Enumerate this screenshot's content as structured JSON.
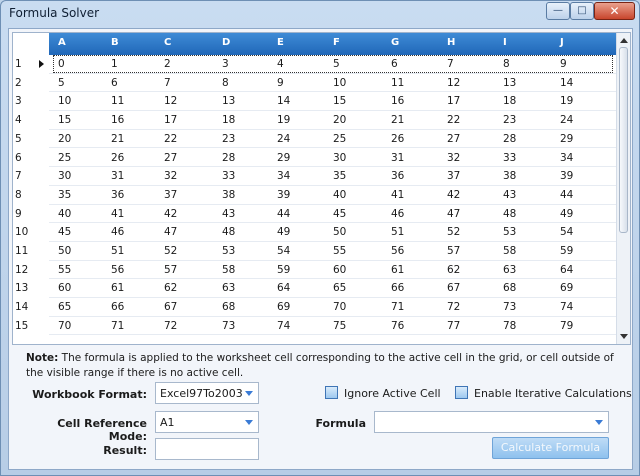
{
  "window": {
    "title": "Formula Solver",
    "controls": {
      "minimize": "—",
      "maximize": "□",
      "close": "✕"
    }
  },
  "grid": {
    "columns": [
      "A",
      "B",
      "C",
      "D",
      "E",
      "F",
      "G",
      "H",
      "I",
      "J"
    ],
    "active_row": 0,
    "rows": [
      {
        "num": "1",
        "cells": [
          "0",
          "1",
          "2",
          "3",
          "4",
          "5",
          "6",
          "7",
          "8",
          "9"
        ]
      },
      {
        "num": "2",
        "cells": [
          "5",
          "6",
          "7",
          "8",
          "9",
          "10",
          "11",
          "12",
          "13",
          "14"
        ]
      },
      {
        "num": "3",
        "cells": [
          "10",
          "11",
          "12",
          "13",
          "14",
          "15",
          "16",
          "17",
          "18",
          "19"
        ]
      },
      {
        "num": "4",
        "cells": [
          "15",
          "16",
          "17",
          "18",
          "19",
          "20",
          "21",
          "22",
          "23",
          "24"
        ]
      },
      {
        "num": "5",
        "cells": [
          "20",
          "21",
          "22",
          "23",
          "24",
          "25",
          "26",
          "27",
          "28",
          "29"
        ]
      },
      {
        "num": "6",
        "cells": [
          "25",
          "26",
          "27",
          "28",
          "29",
          "30",
          "31",
          "32",
          "33",
          "34"
        ]
      },
      {
        "num": "7",
        "cells": [
          "30",
          "31",
          "32",
          "33",
          "34",
          "35",
          "36",
          "37",
          "38",
          "39"
        ]
      },
      {
        "num": "8",
        "cells": [
          "35",
          "36",
          "37",
          "38",
          "39",
          "40",
          "41",
          "42",
          "43",
          "44"
        ]
      },
      {
        "num": "9",
        "cells": [
          "40",
          "41",
          "42",
          "43",
          "44",
          "45",
          "46",
          "47",
          "48",
          "49"
        ]
      },
      {
        "num": "10",
        "cells": [
          "45",
          "46",
          "47",
          "48",
          "49",
          "50",
          "51",
          "52",
          "53",
          "54"
        ]
      },
      {
        "num": "11",
        "cells": [
          "50",
          "51",
          "52",
          "53",
          "54",
          "55",
          "56",
          "57",
          "58",
          "59"
        ]
      },
      {
        "num": "12",
        "cells": [
          "55",
          "56",
          "57",
          "58",
          "59",
          "60",
          "61",
          "62",
          "63",
          "64"
        ]
      },
      {
        "num": "13",
        "cells": [
          "60",
          "61",
          "62",
          "63",
          "64",
          "65",
          "66",
          "67",
          "68",
          "69"
        ]
      },
      {
        "num": "14",
        "cells": [
          "65",
          "66",
          "67",
          "68",
          "69",
          "70",
          "71",
          "72",
          "73",
          "74"
        ]
      },
      {
        "num": "15",
        "cells": [
          "70",
          "71",
          "72",
          "73",
          "74",
          "75",
          "76",
          "77",
          "78",
          "79"
        ]
      }
    ]
  },
  "note": {
    "prefix": "Note:",
    "text": " The formula is applied to the worksheet cell corresponding to the active cell in the grid, or cell outside of the visible range if there is no active cell."
  },
  "form": {
    "workbook_format_label": "Workbook Format:",
    "workbook_format_value": "Excel97To2003",
    "cell_reference_mode_label": "Cell Reference Mode:",
    "cell_reference_mode_value": "A1",
    "result_label": "Result:",
    "result_value": "",
    "ignore_active_cell_label": "Ignore Active Cell",
    "enable_iterative_label": "Enable Iterative Calculations",
    "formula_label": "Formula",
    "formula_value": "",
    "calculate_button": "Calculate Formula"
  }
}
